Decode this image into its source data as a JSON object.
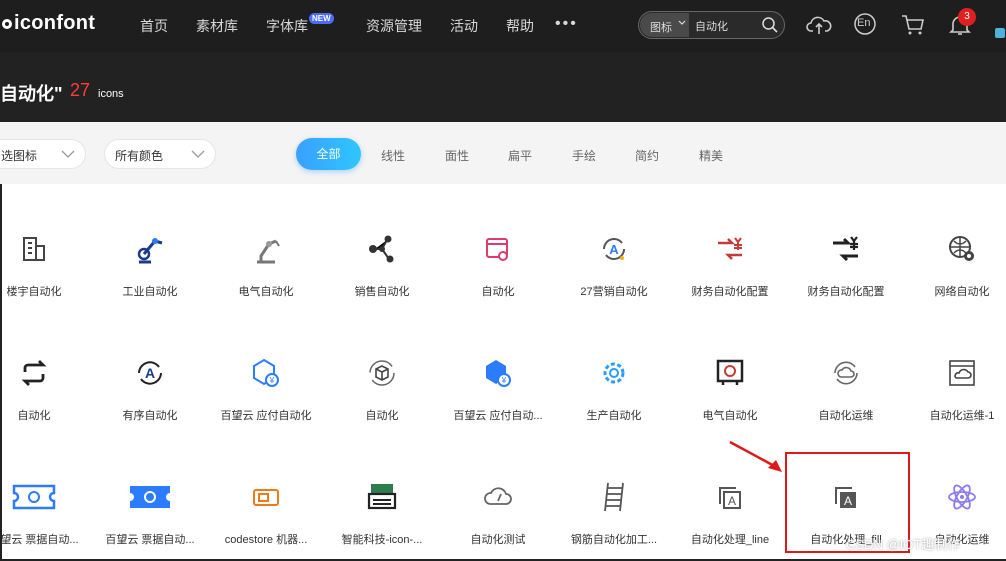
{
  "brand": {
    "logo_text": "iconfont"
  },
  "nav": {
    "items": [
      {
        "label": "首页"
      },
      {
        "label": "素材库"
      },
      {
        "label": "字体库",
        "badge": "NEW"
      },
      {
        "label": "资源管理"
      },
      {
        "label": "活动"
      },
      {
        "label": "帮助"
      }
    ],
    "more": "•••"
  },
  "search": {
    "type_label": "图标",
    "query": "自动化"
  },
  "notifications": {
    "count": "3"
  },
  "lang_label": "En",
  "header": {
    "title": "自动化\"",
    "count": "27",
    "unit": "icons"
  },
  "filters": {
    "select_1": "选图标",
    "select_2": "所有颜色",
    "tabs": [
      {
        "label": "全部",
        "active": true
      },
      {
        "label": "线性"
      },
      {
        "label": "面性"
      },
      {
        "label": "扁平"
      },
      {
        "label": "手绘"
      },
      {
        "label": "简约"
      },
      {
        "label": "精美"
      }
    ]
  },
  "icons": [
    {
      "label": "楼宇自动化",
      "icon": "building-icon"
    },
    {
      "label": "工业自动化",
      "icon": "robot-arm-blue-icon"
    },
    {
      "label": "电气自动化",
      "icon": "robot-arm-gray-icon"
    },
    {
      "label": "销售自动化",
      "icon": "network-nodes-icon"
    },
    {
      "label": "自动化",
      "icon": "browser-gear-icon"
    },
    {
      "label": "27营销自动化",
      "icon": "a-cycle-icon"
    },
    {
      "label": "财务自动化配置",
      "icon": "finance-red-icon"
    },
    {
      "label": "财务自动化配置",
      "icon": "finance-dark-icon"
    },
    {
      "label": "网络自动化",
      "icon": "globe-gear-icon"
    },
    {
      "label": "自动化",
      "icon": "sync-icon"
    },
    {
      "label": "有序自动化",
      "icon": "a-circle-icon"
    },
    {
      "label": "百望云 应付自动化",
      "icon": "hexagon-yen-icon"
    },
    {
      "label": "自动化",
      "icon": "box-cycle-icon"
    },
    {
      "label": "百望云 应付自动...",
      "icon": "hexagon-yen-solid-icon"
    },
    {
      "label": "生产自动化",
      "icon": "gear-blue-icon"
    },
    {
      "label": "电气自动化",
      "icon": "panel-gear-icon"
    },
    {
      "label": "自动化运维",
      "icon": "cloud-cycle-icon"
    },
    {
      "label": "自动化运维-1",
      "icon": "window-cloud-icon"
    },
    {
      "label": "百望云 票据自动...",
      "icon": "ticket-outline-icon"
    },
    {
      "label": "百望云 票据自动...",
      "icon": "ticket-solid-icon"
    },
    {
      "label": "codestore 机器...",
      "icon": "card-orange-icon"
    },
    {
      "label": "智能科技-icon-...",
      "icon": "printer-icon"
    },
    {
      "label": "自动化测试",
      "icon": "cloud-gauge-icon"
    },
    {
      "label": "钢筋自动化加工...",
      "icon": "ladder-icon"
    },
    {
      "label": "自动化处理_line",
      "icon": "a-layer-line-icon"
    },
    {
      "label": "自动化处理_fill",
      "icon": "a-layer-fill-icon"
    },
    {
      "label": "自动化运维",
      "icon": "atom-icon"
    }
  ],
  "watermark": "CSDN @IOT趣制作",
  "colors": {
    "accent": "#2ea8ff",
    "highlight": "#e01818",
    "count": "#ff3b3b"
  }
}
